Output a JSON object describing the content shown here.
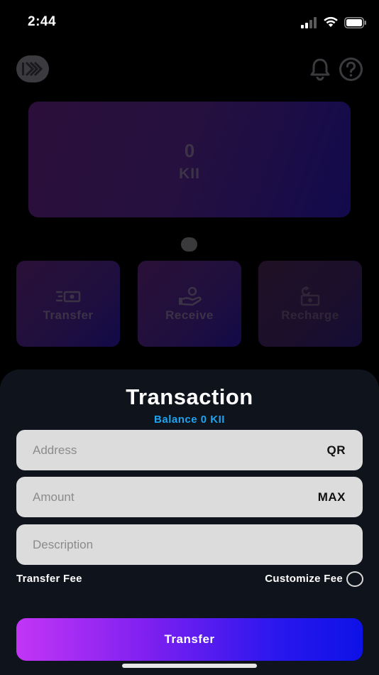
{
  "status_bar": {
    "time": "2:44"
  },
  "home": {
    "balance_card": {
      "amount": "0",
      "unit": "KII"
    },
    "actions": [
      {
        "label": "Transfer",
        "icon": "cash-transfer-icon"
      },
      {
        "label": "Receive",
        "icon": "hand-receive-icon"
      },
      {
        "label": "Recharge",
        "icon": "cash-recharge-icon"
      }
    ]
  },
  "sheet": {
    "title": "Transaction",
    "balance": "Balance 0 KII",
    "address": {
      "placeholder": "Address",
      "value": "",
      "action": "QR"
    },
    "amount": {
      "placeholder": "Amount",
      "value": "",
      "action": "MAX"
    },
    "description": {
      "placeholder": "Description",
      "value": ""
    },
    "transfer_fee_label": "Transfer Fee",
    "customize_fee_label": "Customize Fee",
    "transfer_button": "Transfer"
  },
  "colors": {
    "sheet_background": "#0f131b",
    "balance_accent": "#1fa3ee",
    "button_gradient_start": "#c235f5",
    "button_gradient_end": "#0d12e6"
  }
}
